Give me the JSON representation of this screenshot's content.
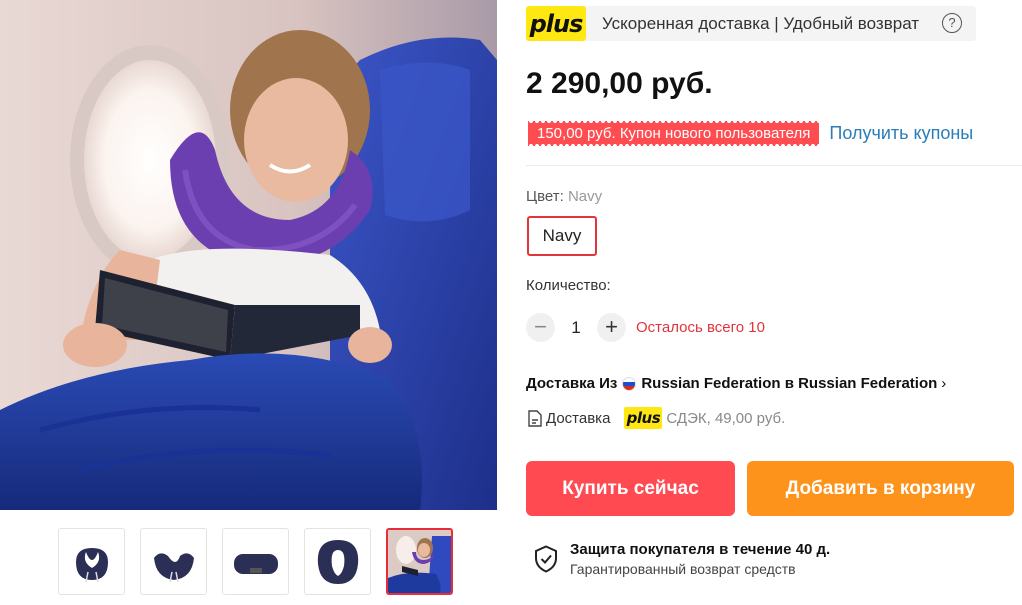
{
  "plus_bar": {
    "logo": "plus",
    "text": "Ускоренная доставка | Удобный возврат",
    "help_icon": "question-circle-icon"
  },
  "price": "2 290,00 руб.",
  "coupon": {
    "label": "150,00 руб. Купон нового пользователя",
    "link": "Получить купоны"
  },
  "color": {
    "label": "Цвет:",
    "value": "Navy",
    "options": [
      "Navy"
    ]
  },
  "quantity": {
    "label": "Количество:",
    "minus": "−",
    "value": "1",
    "plus": "+",
    "stock": "Осталось всего 10"
  },
  "delivery": {
    "from_prefix": "Доставка Из",
    "route": "Russian Federation в Russian Federation",
    "chevron": "›",
    "label": "Доставка",
    "plus_logo": "plus",
    "method": "СДЭК, 49,00 руб."
  },
  "actions": {
    "buy_now": "Купить сейчас",
    "add_to_cart": "Добавить в корзину"
  },
  "protection": {
    "title": "Защита покупателя в течение 40 д.",
    "subtitle": "Гарантированный возврат средств"
  },
  "gallery": {
    "thumbnails": [
      "pillow-front",
      "pillow-angle",
      "pillow-side",
      "pillow-top",
      "woman-on-plane"
    ],
    "active_index": 4
  },
  "colors": {
    "accent_red": "#ff4a51",
    "accent_orange": "#fd931b",
    "plus_yellow": "#ffe812",
    "link_blue": "#2a7db8"
  }
}
